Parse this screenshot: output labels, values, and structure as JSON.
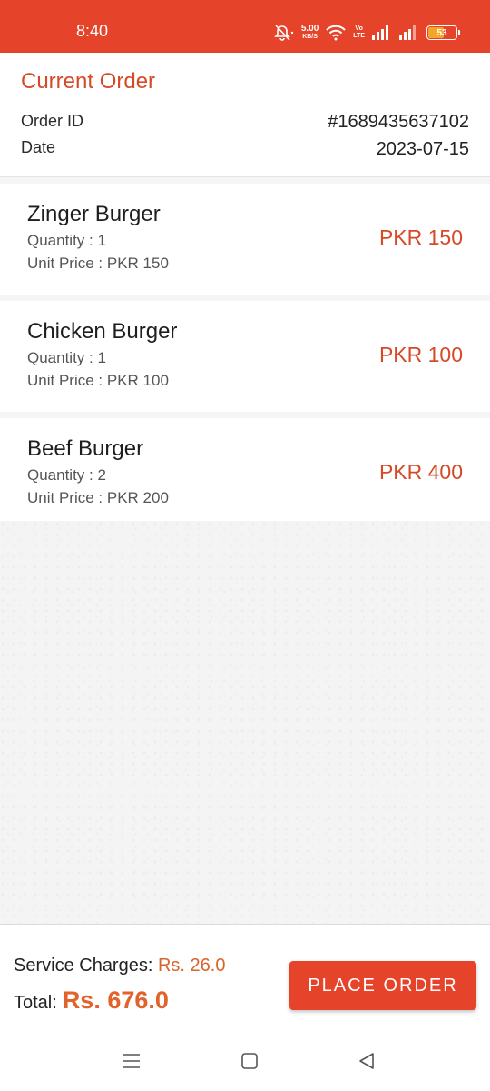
{
  "status_bar": {
    "time": "8:40",
    "net_speed_value": "5.00",
    "net_speed_unit": "KB/S",
    "volte_top": "Vo",
    "volte_bottom": "LTE",
    "battery": "53",
    "battery_level": 0.53,
    "colors": {
      "bar": "#e5432a",
      "battery_fill": "#f4a52a"
    },
    "icons": [
      "mute-icon",
      "wifi-icon",
      "volte-icon",
      "signal-icon",
      "signal-icon",
      "battery-icon"
    ]
  },
  "header": {
    "title": "Current Order",
    "order_id_label": "Order ID",
    "order_id_value": "#1689435637102",
    "date_label": "Date",
    "date_value": "2023-07-15"
  },
  "items": [
    {
      "name": "Zinger Burger",
      "quantity": "Quantity : 1",
      "unit_price": "Unit Price : PKR 150",
      "total": "PKR 150"
    },
    {
      "name": "Chicken Burger",
      "quantity": "Quantity : 1",
      "unit_price": "Unit Price : PKR 100",
      "total": "PKR 100"
    },
    {
      "name": "Beef Burger",
      "quantity": "Quantity : 2",
      "unit_price": "Unit Price : PKR 200",
      "total": "PKR 400"
    }
  ],
  "footer": {
    "service_label": "Service Charges:",
    "service_value": "Rs. 26.0",
    "total_label": "Total:",
    "total_value": "Rs. 676.0",
    "place_order_label": "PLACE ORDER"
  },
  "nav": {
    "icons": [
      "menu-icon",
      "home-icon",
      "back-icon"
    ]
  },
  "colors": {
    "accent": "#e5432a",
    "price": "#d64a28",
    "total_amount": "#e2622b"
  }
}
